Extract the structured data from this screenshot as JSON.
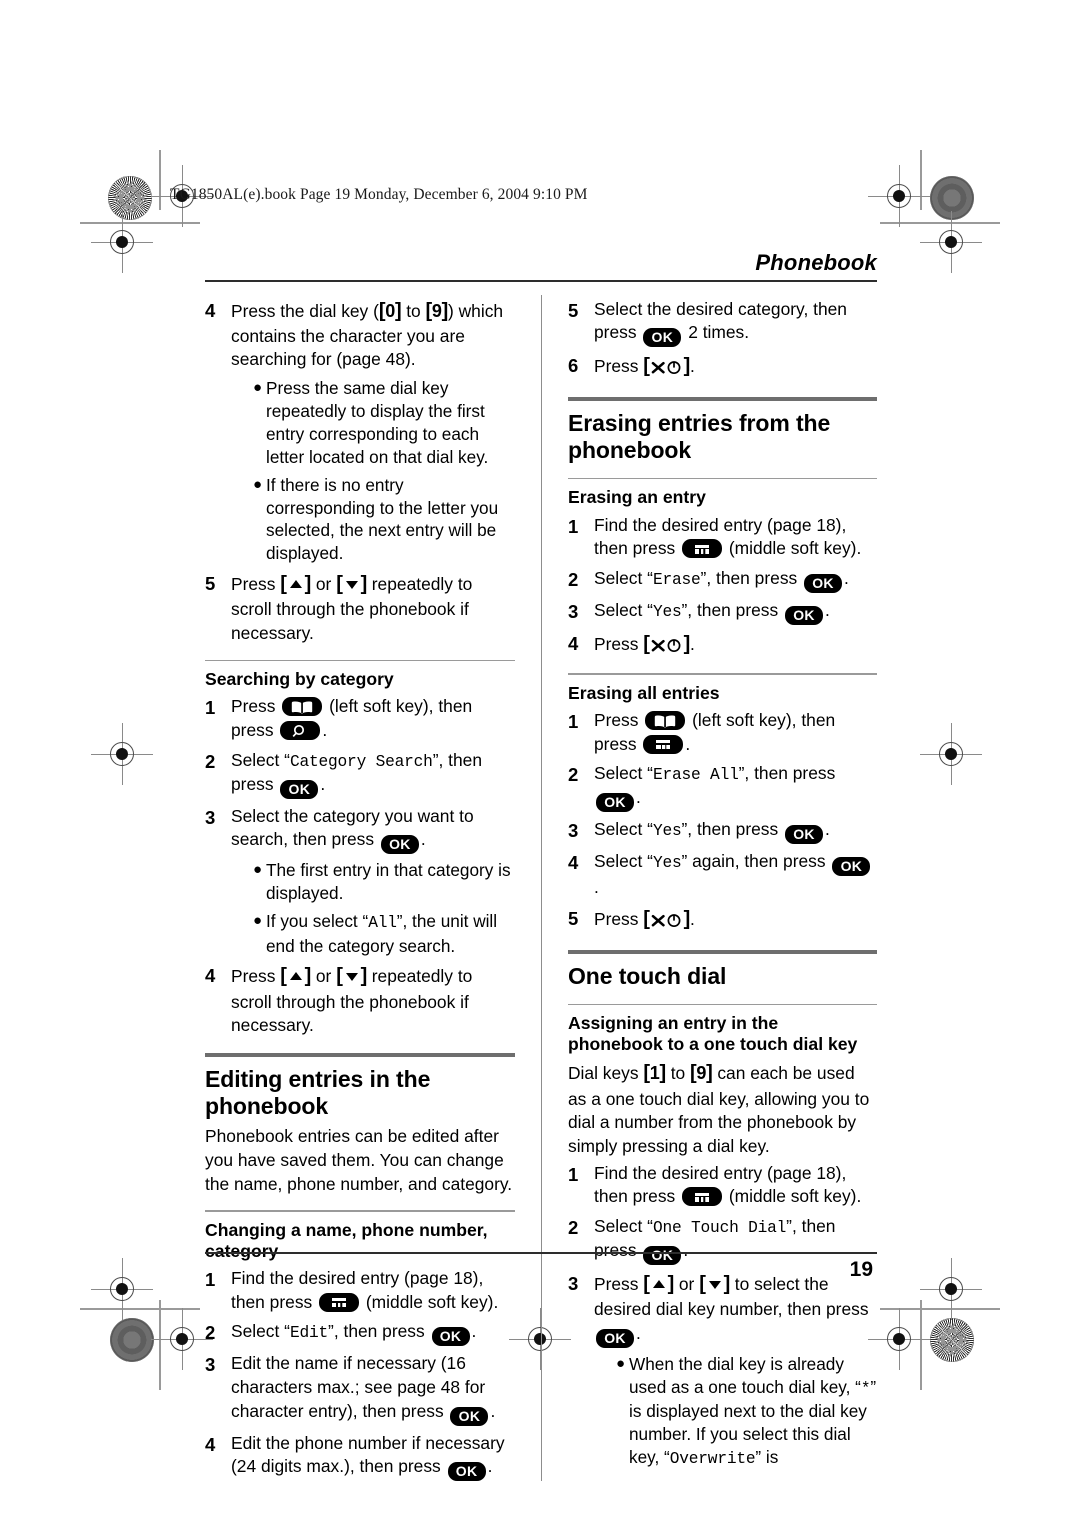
{
  "file_stamp": "TG1850AL(e).book  Page 19  Monday, December 6, 2004  9:10 PM",
  "running_head": "Phonebook",
  "page_number": "19",
  "icons": {
    "left_soft_key": "book-icon",
    "middle_soft_key": "grid-icon",
    "search_key": "magnifier-icon",
    "ok_key": "OK",
    "power_off_key": "phone-off-icon"
  },
  "left_column": {
    "continued_steps": [
      {
        "num": "4",
        "text_a": "Press the dial key (",
        "key_a": "0",
        "text_b": " to ",
        "key_b": "9",
        "text_c": ") which contains the character you are searching for (page 48).",
        "bullets": [
          "Press the same dial key repeatedly to display the first entry corresponding to each letter located on that dial key.",
          "If there is no entry corresponding to the letter you selected, the next entry will be displayed."
        ]
      },
      {
        "num": "5",
        "text_a": "Press ",
        "text_b": " or ",
        "text_c": " repeatedly to scroll through the phonebook if necessary."
      }
    ],
    "searching_by_category": {
      "heading": "Searching by category",
      "steps": [
        {
          "num": "1",
          "text_a": "Press ",
          "text_b": " (left soft key), then press ",
          "text_c": "."
        },
        {
          "num": "2",
          "text_a": "Select “",
          "mono": "Category Search",
          "text_b": "”, then press ",
          "text_c": "."
        },
        {
          "num": "3",
          "text_a": "Select the category you want to search, then press ",
          "text_c": ".",
          "bullets": [
            "The first entry in that category is displayed.",
            "If you select “All”, the unit will end the category search."
          ],
          "bullet_mono": [
            "",
            "All"
          ]
        },
        {
          "num": "4",
          "text_a": "Press ",
          "text_b": " or ",
          "text_c": " repeatedly to scroll through the phonebook if necessary."
        }
      ]
    },
    "editing_section": {
      "title": "Editing entries in the phonebook",
      "intro": "Phonebook entries can be edited after you have saved them. You can change the name, phone number, and category.",
      "sub_heading": "Changing a name, phone number, category",
      "steps": [
        {
          "num": "1",
          "text_a": "Find the desired entry (page 18), then press ",
          "text_b": " (middle soft key)."
        },
        {
          "num": "2",
          "text_a": "Select “",
          "mono": "Edit",
          "text_b": "”, then press ",
          "text_c": "."
        },
        {
          "num": "3",
          "text_a": "Edit the name if necessary (16 characters max.; see page 48 for character entry), then press ",
          "text_c": "."
        },
        {
          "num": "4",
          "text_a": "Edit the phone number if necessary (24 digits max.), then press ",
          "text_c": "."
        }
      ]
    }
  },
  "right_column": {
    "continued_steps": [
      {
        "num": "5",
        "text_a": "Select the desired category, then press ",
        "text_b": " 2 times."
      },
      {
        "num": "6",
        "text_a": "Press ",
        "text_c": "."
      }
    ],
    "erasing_section": {
      "title": "Erasing entries from the phonebook",
      "erasing_an_entry": {
        "heading": "Erasing an entry",
        "steps": [
          {
            "num": "1",
            "text_a": "Find the desired entry (page 18), then press ",
            "text_b": " (middle soft key)."
          },
          {
            "num": "2",
            "text_a": "Select “",
            "mono": "Erase",
            "text_b": "”, then press ",
            "text_c": "."
          },
          {
            "num": "3",
            "text_a": "Select “",
            "mono": "Yes",
            "text_b": "”, then press ",
            "text_c": "."
          },
          {
            "num": "4",
            "text_a": "Press ",
            "text_c": "."
          }
        ]
      },
      "erasing_all_entries": {
        "heading": "Erasing all entries",
        "steps": [
          {
            "num": "1",
            "text_a": "Press ",
            "text_b": " (left soft key), then press ",
            "text_c": "."
          },
          {
            "num": "2",
            "text_a": "Select “",
            "mono": "Erase All",
            "text_b": "”, then press ",
            "text_c": "."
          },
          {
            "num": "3",
            "text_a": "Select “",
            "mono": "Yes",
            "text_b": "”, then press ",
            "text_c": "."
          },
          {
            "num": "4",
            "text_a": "Select “",
            "mono": "Yes",
            "text_b": "” again, then press ",
            "text_c": "."
          },
          {
            "num": "5",
            "text_a": "Press ",
            "text_c": "."
          }
        ]
      }
    },
    "one_touch_section": {
      "title": "One touch dial",
      "sub_heading": "Assigning an entry in the phonebook to a one touch dial key",
      "intro_a": "Dial keys ",
      "intro_key_a": "1",
      "intro_b": " to ",
      "intro_key_b": "9",
      "intro_c": " can each be used as a one touch dial key, allowing you to dial a number from the phonebook by simply pressing a dial key.",
      "steps": [
        {
          "num": "1",
          "text_a": "Find the desired entry (page 18), then press ",
          "text_b": " (middle soft key)."
        },
        {
          "num": "2",
          "text_a": "Select “",
          "mono": "One Touch Dial",
          "text_b": "”, then press ",
          "text_c": "."
        },
        {
          "num": "3",
          "text_a": "Press ",
          "text_b": " or ",
          "text_c": " to select the desired dial key number, then press ",
          "text_d": ".",
          "bullet_a": "When the dial key is already used as a one touch dial key, “",
          "bullet_mono_a": "*",
          "bullet_b": "” is displayed next to the dial key number. If you select this dial key, “",
          "bullet_mono_b": "Overwrite",
          "bullet_c": "” is"
        }
      ]
    }
  }
}
